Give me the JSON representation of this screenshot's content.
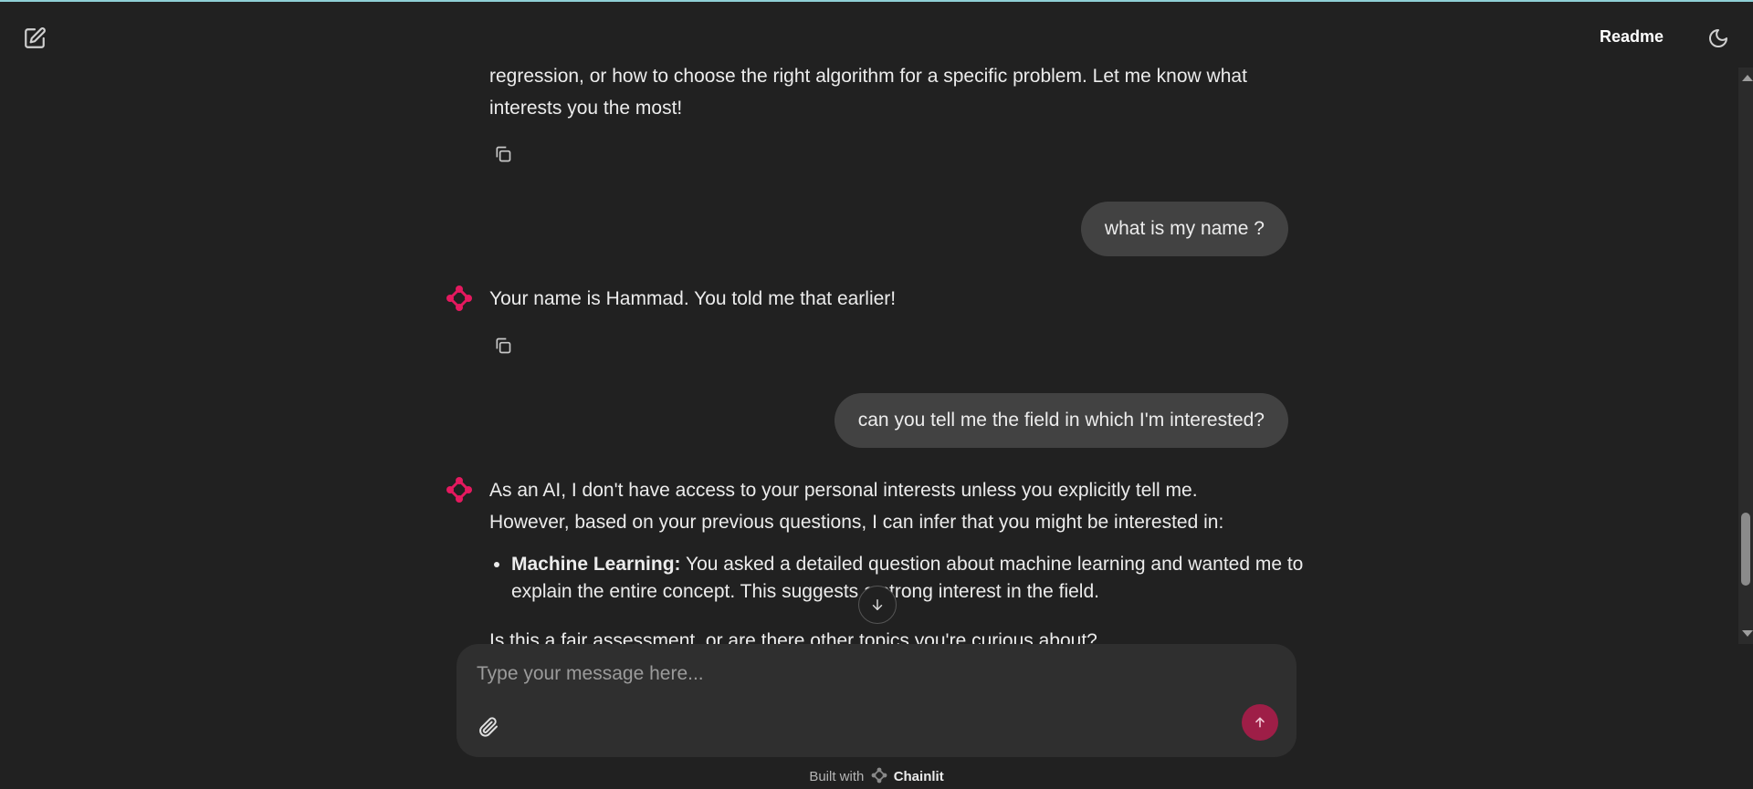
{
  "header": {
    "new_chat_icon": "edit-square-icon",
    "readme_label": "Readme",
    "theme_icon": "moon-icon"
  },
  "messages": [
    {
      "role": "assistant",
      "text_line1": "regression, or how to choose the right algorithm for a specific problem. Let me know what",
      "text_line2": "interests you the most!"
    },
    {
      "role": "user",
      "text": "what is my name ?"
    },
    {
      "role": "assistant",
      "text": "Your name is Hammad. You told me that earlier!"
    },
    {
      "role": "user",
      "text": "can you tell me the field in which I'm interested?"
    },
    {
      "role": "assistant",
      "text_line1": "As an AI, I don't have access to your personal interests unless you explicitly tell me.",
      "text_line2": "However, based on your previous questions, I can infer that you might be interested in:",
      "bullet_bold": "Machine Learning:",
      "bullet_text": " You asked a detailed question about machine learning and wanted me to explain the entire concept. This suggests a strong interest in the field.",
      "closing": "Is this a fair assessment, or are there other topics you're curious about?"
    }
  ],
  "composer": {
    "placeholder": "Type your message here...",
    "attach_icon": "paperclip-icon",
    "send_icon": "arrow-up-icon"
  },
  "footer": {
    "built_with": "Built with",
    "brand": "Chainlit"
  },
  "colors": {
    "background": "#212121",
    "bubble": "#424242",
    "composer": "#2f2f2f",
    "accent": "#e5195f",
    "send_button": "#9e1e47"
  }
}
